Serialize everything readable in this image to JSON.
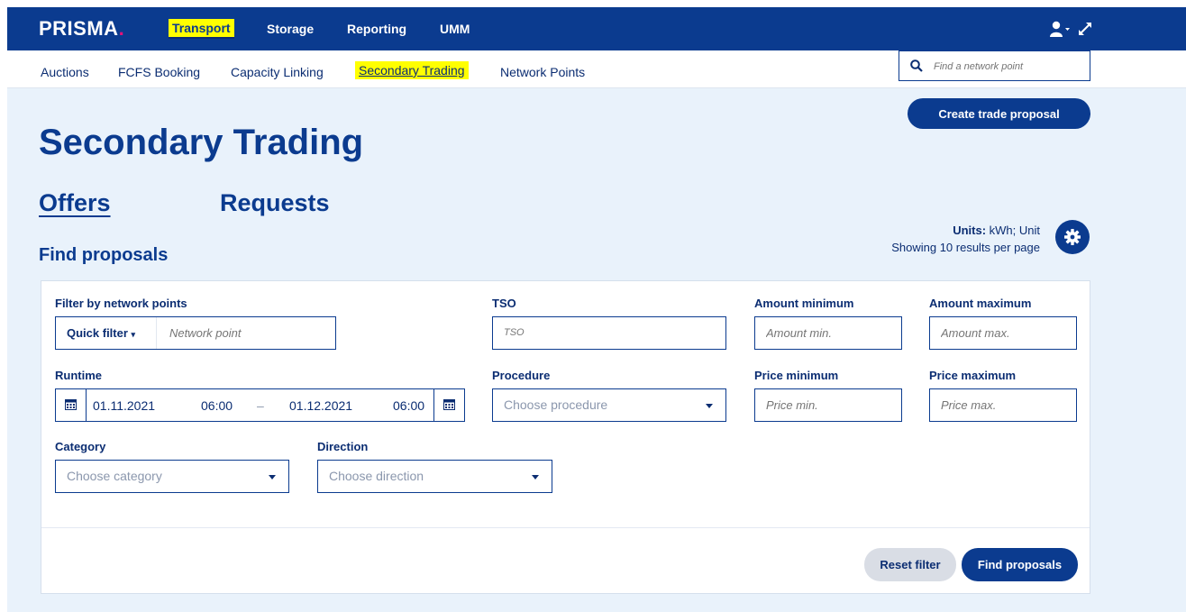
{
  "app": {
    "logo": "PRISMA",
    "logo_dot": "."
  },
  "topnav": {
    "transport": "Transport",
    "storage": "Storage",
    "reporting": "Reporting",
    "umm": "UMM"
  },
  "subnav": {
    "auctions": "Auctions",
    "fcfs": "FCFS Booking",
    "linking": "Capacity Linking",
    "secondary": "Secondary Trading",
    "network": "Network Points"
  },
  "search": {
    "placeholder": "Find a network point"
  },
  "main": {
    "create_button": "Create trade proposal",
    "title": "Secondary Trading",
    "tabs": {
      "offers": "Offers",
      "requests": "Requests"
    },
    "find_title": "Find proposals",
    "units_label": "Units:",
    "units_value": "kWh; Unit",
    "results_text": "Showing 10 results per page"
  },
  "filters": {
    "network_points_label": "Filter by network points",
    "quick_filter": "Quick filter",
    "network_point_placeholder": "Network point",
    "tso_label": "TSO",
    "tso_placeholder": "TSO",
    "amount_min_label": "Amount minimum",
    "amount_min_placeholder": "Amount min.",
    "amount_max_label": "Amount maximum",
    "amount_max_placeholder": "Amount max.",
    "runtime_label": "Runtime",
    "runtime_start_date": "01.11.2021",
    "runtime_start_time": "06:00",
    "runtime_separator": "–",
    "runtime_end_date": "01.12.2021",
    "runtime_end_time": "06:00",
    "procedure_label": "Procedure",
    "procedure_placeholder": "Choose procedure",
    "price_min_label": "Price minimum",
    "price_min_placeholder": "Price min.",
    "price_max_label": "Price maximum",
    "price_max_placeholder": "Price max.",
    "category_label": "Category",
    "category_placeholder": "Choose category",
    "direction_label": "Direction",
    "direction_placeholder": "Choose direction",
    "reset_button": "Reset filter",
    "find_button": "Find proposals"
  },
  "colors": {
    "brand": "#0b3b8f",
    "accent_dot": "#e4127a",
    "highlight": "#ffff00",
    "background": "#e9f2fb"
  }
}
